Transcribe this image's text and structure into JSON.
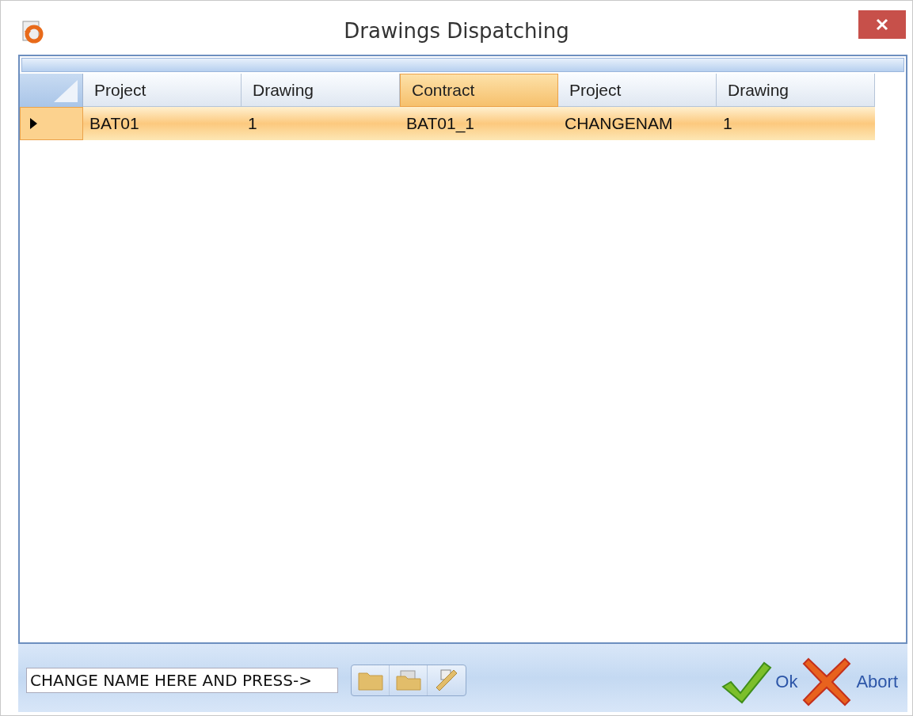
{
  "window": {
    "title": "Drawings Dispatching"
  },
  "table": {
    "columns": [
      {
        "label": "Project",
        "selected": false
      },
      {
        "label": "Drawing",
        "selected": false
      },
      {
        "label": "Contract",
        "selected": true
      },
      {
        "label": "Project",
        "selected": false
      },
      {
        "label": "Drawing",
        "selected": false
      }
    ],
    "rows": [
      {
        "selected": true,
        "cells": [
          "BAT01",
          "1",
          "BAT01_1",
          "CHANGENAM",
          "1"
        ]
      }
    ]
  },
  "name_field": {
    "value": "CHANGE NAME HERE AND PRESS->"
  },
  "buttons": [
    {
      "label": "Ok",
      "kind": "ok"
    },
    {
      "label": "Abort",
      "kind": "abort"
    }
  ]
}
